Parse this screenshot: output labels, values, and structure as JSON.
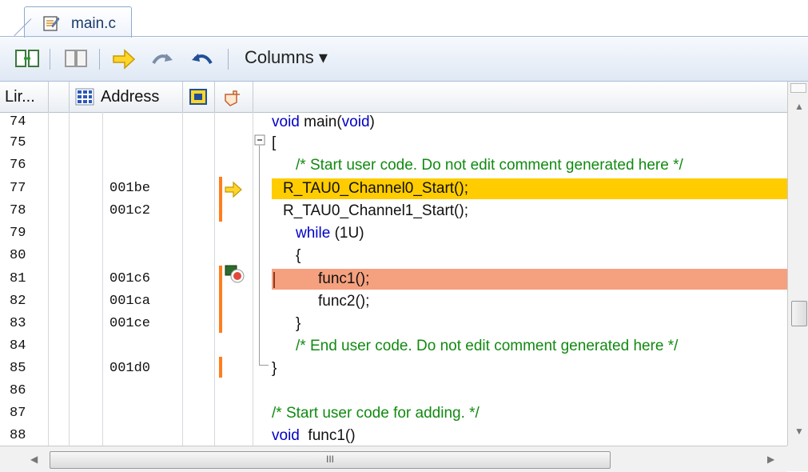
{
  "tab": {
    "label": "main.c"
  },
  "toolbar": {
    "columns_label": "Columns ▾"
  },
  "headers": {
    "line": "Lir...",
    "address": "Address"
  },
  "rows": [
    {
      "line": "74",
      "addr": "",
      "code": [
        {
          "t": "void main(void)",
          "c": "kw-part"
        }
      ]
    },
    {
      "line": "75",
      "addr": "",
      "code": []
    },
    {
      "line": "76",
      "addr": "",
      "code": []
    },
    {
      "line": "77",
      "addr": "001be",
      "code": []
    },
    {
      "line": "78",
      "addr": "001c2",
      "code": []
    },
    {
      "line": "79",
      "addr": "",
      "code": []
    },
    {
      "line": "80",
      "addr": "",
      "code": []
    },
    {
      "line": "81",
      "addr": "001c6",
      "code": []
    },
    {
      "line": "82",
      "addr": "001ca",
      "code": []
    },
    {
      "line": "83",
      "addr": "001ce",
      "code": []
    },
    {
      "line": "84",
      "addr": "",
      "code": []
    },
    {
      "line": "85",
      "addr": "001d0",
      "code": []
    },
    {
      "line": "86",
      "addr": "",
      "code": []
    },
    {
      "line": "87",
      "addr": "",
      "code": []
    },
    {
      "line": "88",
      "addr": "",
      "code": []
    }
  ],
  "code": {
    "l74_kw": "void",
    "l74_rest": " main(",
    "l74_kw2": "void",
    "l74_end": ")",
    "l75": "[",
    "l76": "/* Start user code. Do not edit comment generated here */",
    "l77": "R_TAU0_Channel0_Start();",
    "l78": "R_TAU0_Channel1_Start();",
    "l79_kw": "while",
    "l79_rest": " (1U)",
    "l80": "{",
    "l81": "func1();",
    "l82": "func2();",
    "l83": "}",
    "l84": "/* End user code. Do not edit comment generated here */",
    "l85": "}",
    "l87": "/* Start user code for adding. */",
    "l88_kw": "void",
    "l88_rest": "  func1()"
  },
  "scroll": {
    "h_thumb_grip": "III"
  },
  "colors": {
    "current_line": "#ffcc00",
    "breakpoint_line": "#f5a17f",
    "coverage": "#ff7e1c",
    "keyword": "#0000c8",
    "comment": "#118a11"
  }
}
